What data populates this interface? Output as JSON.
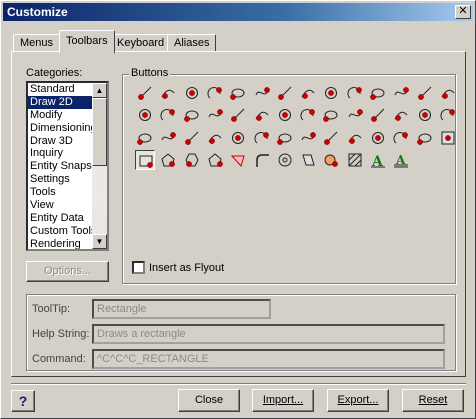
{
  "window": {
    "title": "Customize"
  },
  "tabs": [
    {
      "label": "Menus",
      "active": false
    },
    {
      "label": "Toolbars",
      "active": true
    },
    {
      "label": "Keyboard",
      "active": false
    },
    {
      "label": "Aliases",
      "active": false
    }
  ],
  "categories": {
    "label": "Categories:",
    "items": [
      "Standard",
      "Draw 2D",
      "Modify",
      "Dimensioning",
      "Draw 3D",
      "Inquiry",
      "Entity Snaps",
      "Settings",
      "Tools",
      "View",
      "Entity Data",
      "Custom Tools",
      "Rendering"
    ],
    "selected_index": 1
  },
  "options_button": "Options...",
  "buttons_group": {
    "label": "Buttons",
    "icons": [
      [
        "line-icon",
        "polyline-icon",
        "line-arc-icon",
        "ray-icon",
        "box-icon",
        "freehand-icon",
        "pencil-icon",
        "circle-center-icon",
        "circle-2pt-icon",
        "circle-3pt-icon",
        "arc-icon",
        "donut-icon",
        "ellipse-icon",
        "circle-tangent-icon"
      ],
      [
        "arc-3pt-icon",
        "arc-start-center-icon",
        "arc-center-icon",
        "arc-end-icon",
        "arc-tangent-icon",
        "arc-direction-icon",
        "arc-continue-icon",
        "ellipse-arc-icon",
        "ellipse-axis-icon",
        "ellipse-center-icon",
        "spline-icon",
        "helix-icon",
        "cloud-icon",
        "tangent-arc-icon"
      ],
      [
        "point-icon",
        "polygon-icon",
        "rect-icon",
        "hatch-icon",
        "boundary-icon",
        "region-icon",
        "wipeout-icon",
        "revcloud-icon",
        "xline-icon",
        "ray2-icon",
        "mline-icon",
        "multipoint-icon",
        "divide-icon",
        "measure-icon"
      ],
      [
        "rectangle-icon",
        "pentagon-icon",
        "hexagon-icon",
        "polygon-side-icon",
        "solid-fill-icon",
        "fillet-corner-icon",
        "target-icon",
        "trace-icon",
        "donut-fill-icon",
        "hatch-pattern-icon",
        "text-icon",
        "mtext-icon"
      ]
    ],
    "selected": "rectangle-icon"
  },
  "insert_flyout": {
    "label": "Insert as Flyout",
    "checked": false
  },
  "details": {
    "tooltip_label": "ToolTip:",
    "tooltip_value": "Rectangle",
    "help_label": "Help String:",
    "help_value": "Draws a rectangle",
    "command_label": "Command:",
    "command_value": "^C^C^C_RECTANGLE"
  },
  "footer": {
    "help": "?",
    "close": "Close",
    "import": "Import...",
    "export": "Export...",
    "reset": "Reset"
  },
  "colors": {
    "title_start": "#0a246a",
    "selection": "#0a246a",
    "icon_red": "#cc0000",
    "icon_green": "#117a11"
  }
}
